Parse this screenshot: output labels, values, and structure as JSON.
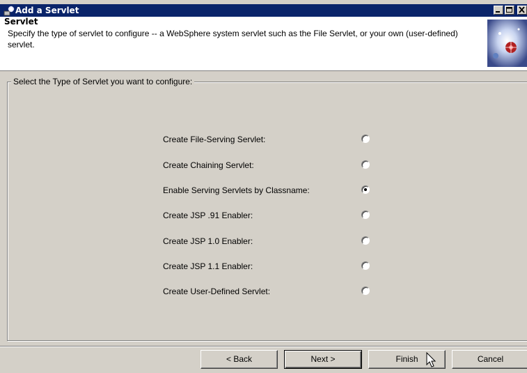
{
  "window": {
    "title": "Add a Servlet",
    "controls": [
      "minimize",
      "maximize",
      "close"
    ]
  },
  "header": {
    "title": "Servlet",
    "description": "Specify the type of servlet to configure -- a WebSphere system servlet such as the File Servlet, or your own (user-defined) servlet."
  },
  "group": {
    "label": "Select the Type of Servlet you want to configure:"
  },
  "options": [
    {
      "label": "Create File-Serving Servlet:",
      "selected": false
    },
    {
      "label": "Create Chaining Servlet:",
      "selected": false
    },
    {
      "label": "Enable Serving Servlets by Classname:",
      "selected": true
    },
    {
      "label": "Create JSP .91 Enabler:",
      "selected": false
    },
    {
      "label": "Create JSP 1.0 Enabler:",
      "selected": false
    },
    {
      "label": "Create JSP 1.1 Enabler:",
      "selected": false
    },
    {
      "label": "Create User-Defined Servlet:",
      "selected": false
    }
  ],
  "buttons": {
    "back": "< Back",
    "next": "Next >",
    "finish": "Finish",
    "cancel": "Cancel"
  },
  "colors": {
    "titlebar": "#0a246a",
    "face": "#d4d0c8"
  }
}
